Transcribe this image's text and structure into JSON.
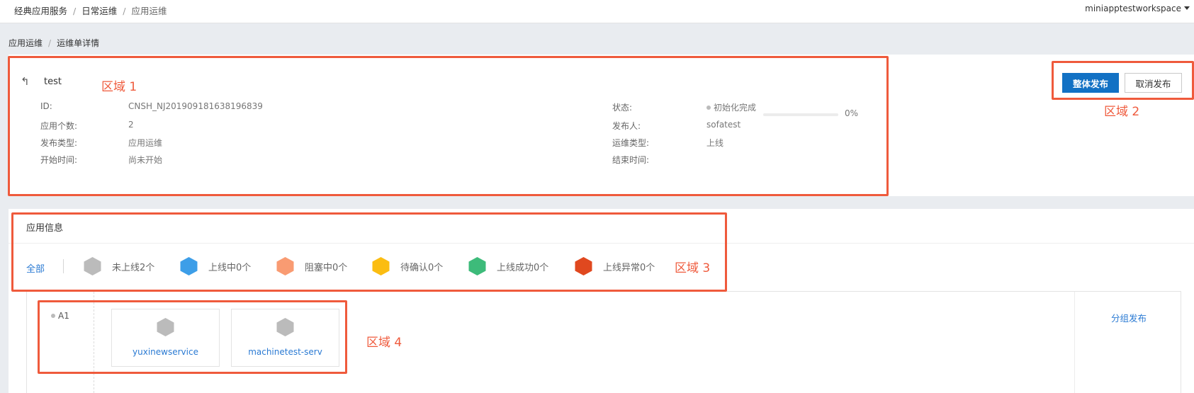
{
  "topbar": {
    "breadcrumb": [
      "经典应用服务",
      "日常运维",
      "应用运维"
    ],
    "workspace": "miniapptestworkspace"
  },
  "subbreadcrumb": [
    "应用运维",
    "运维单详情"
  ],
  "order": {
    "back_icon": "↰",
    "title": "test",
    "fields_left": [
      {
        "label": "ID:",
        "value": "CNSH_NJ201909181638196839"
      },
      {
        "label": "应用个数:",
        "value": "2"
      },
      {
        "label": "发布类型:",
        "value": "应用运维"
      },
      {
        "label": "开始时间:",
        "value": "尚未开始"
      }
    ],
    "fields_right": [
      {
        "label": "状态:",
        "value": "初始化完成"
      },
      {
        "label": "发布人:",
        "value": "sofatest"
      },
      {
        "label": "运维类型:",
        "value": "上线"
      },
      {
        "label": "结束时间:",
        "value": ""
      }
    ],
    "progress_percent": 0,
    "progress_text": "0%"
  },
  "actions": {
    "publish_all": "整体发布",
    "cancel_publish": "取消发布"
  },
  "app_info": {
    "title": "应用信息",
    "filter_all": "全部",
    "filters": [
      {
        "label": "未上线2个",
        "color": "#bbbbbb"
      },
      {
        "label": "上线中0个",
        "color": "#3d9ee8"
      },
      {
        "label": "阻塞中0个",
        "color": "#f99b72"
      },
      {
        "label": "待确认0个",
        "color": "#fbbd12"
      },
      {
        "label": "上线成功0个",
        "color": "#3dbb7a"
      },
      {
        "label": "上线异常0个",
        "color": "#e0481f"
      }
    ],
    "group": {
      "name": "A1",
      "action": "分组发布",
      "services": [
        {
          "name": "yuxinewservice",
          "color": "#bbbbbb"
        },
        {
          "name": "machinetest-serv",
          "color": "#bbbbbb"
        }
      ]
    }
  },
  "annotations": [
    "区域 1",
    "区域 2",
    "区域 3",
    "区域 4"
  ],
  "colors": {
    "accent": "#1271c4",
    "link": "#2a7ad3",
    "annotation": "#ef5a3c"
  }
}
